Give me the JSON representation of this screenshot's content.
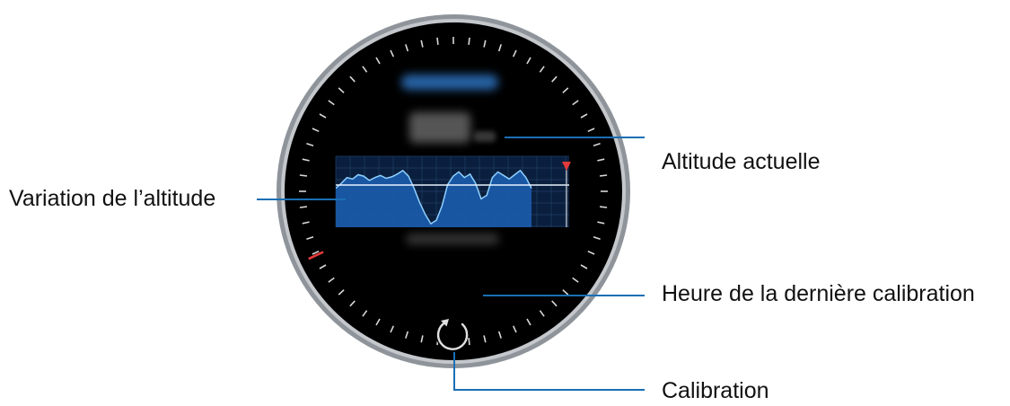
{
  "callouts": {
    "current_altitude": "Altitude actuelle",
    "altitude_variation": "Variation de l’altitude",
    "last_calibration_time": "Heure de la dernière calibration",
    "calibration": "Calibration"
  },
  "watch_screen": {
    "calibrate_icon": "refresh-icon",
    "altitude_chart": {
      "series": [
        0.55,
        0.62,
        0.7,
        0.68,
        0.74,
        0.72,
        0.66,
        0.7,
        0.73,
        0.69,
        0.71,
        0.75,
        0.8,
        0.72,
        0.55,
        0.35,
        0.18,
        0.05,
        0.1,
        0.3,
        0.6,
        0.72,
        0.78,
        0.7,
        0.75,
        0.62,
        0.4,
        0.45,
        0.7,
        0.78,
        0.73,
        0.68,
        0.74,
        0.8,
        0.7,
        0.55
      ],
      "marker_color": "#e23a3a"
    }
  },
  "colors": {
    "leader_line": "#1a6fb5",
    "bezel": "#9aa0a6",
    "screen": "#000000",
    "graph_fill": "#1a5aa8",
    "graph_line": "#8fd0ff",
    "tick": "#d8d8d8",
    "red_tick": "#e23a3a"
  }
}
